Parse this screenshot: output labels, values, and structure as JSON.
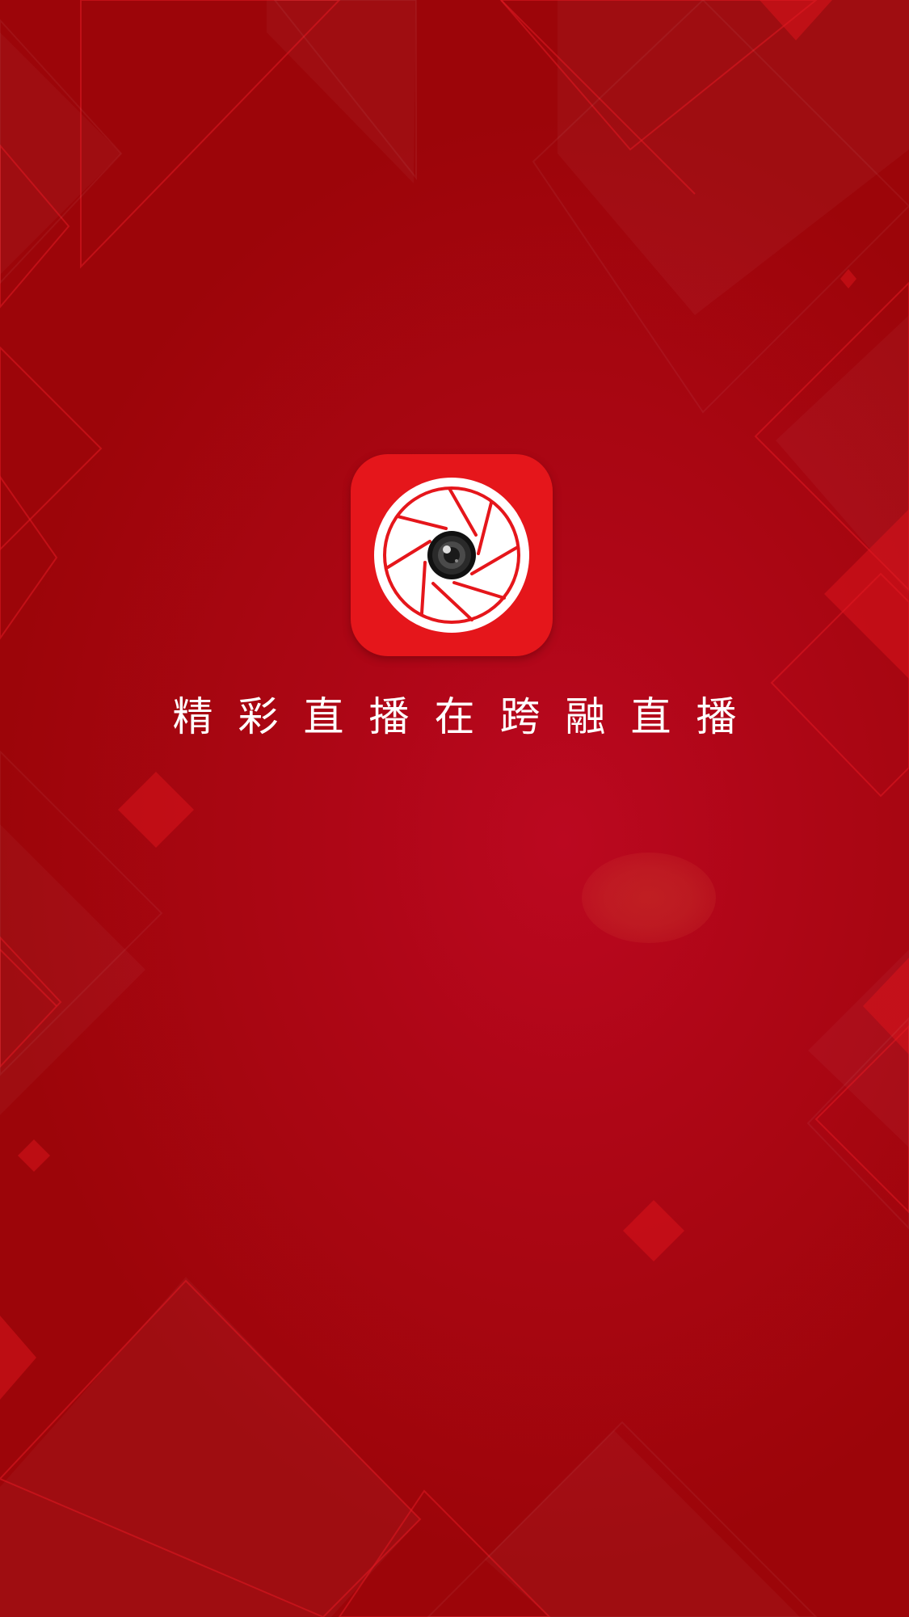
{
  "splash": {
    "tagline": "精彩直播在跨融直播",
    "logo_icon": "camera-aperture-icon",
    "colors": {
      "background": "#a8060f",
      "icon_background": "#e5161b",
      "tagline_text": "#ffffff"
    }
  }
}
